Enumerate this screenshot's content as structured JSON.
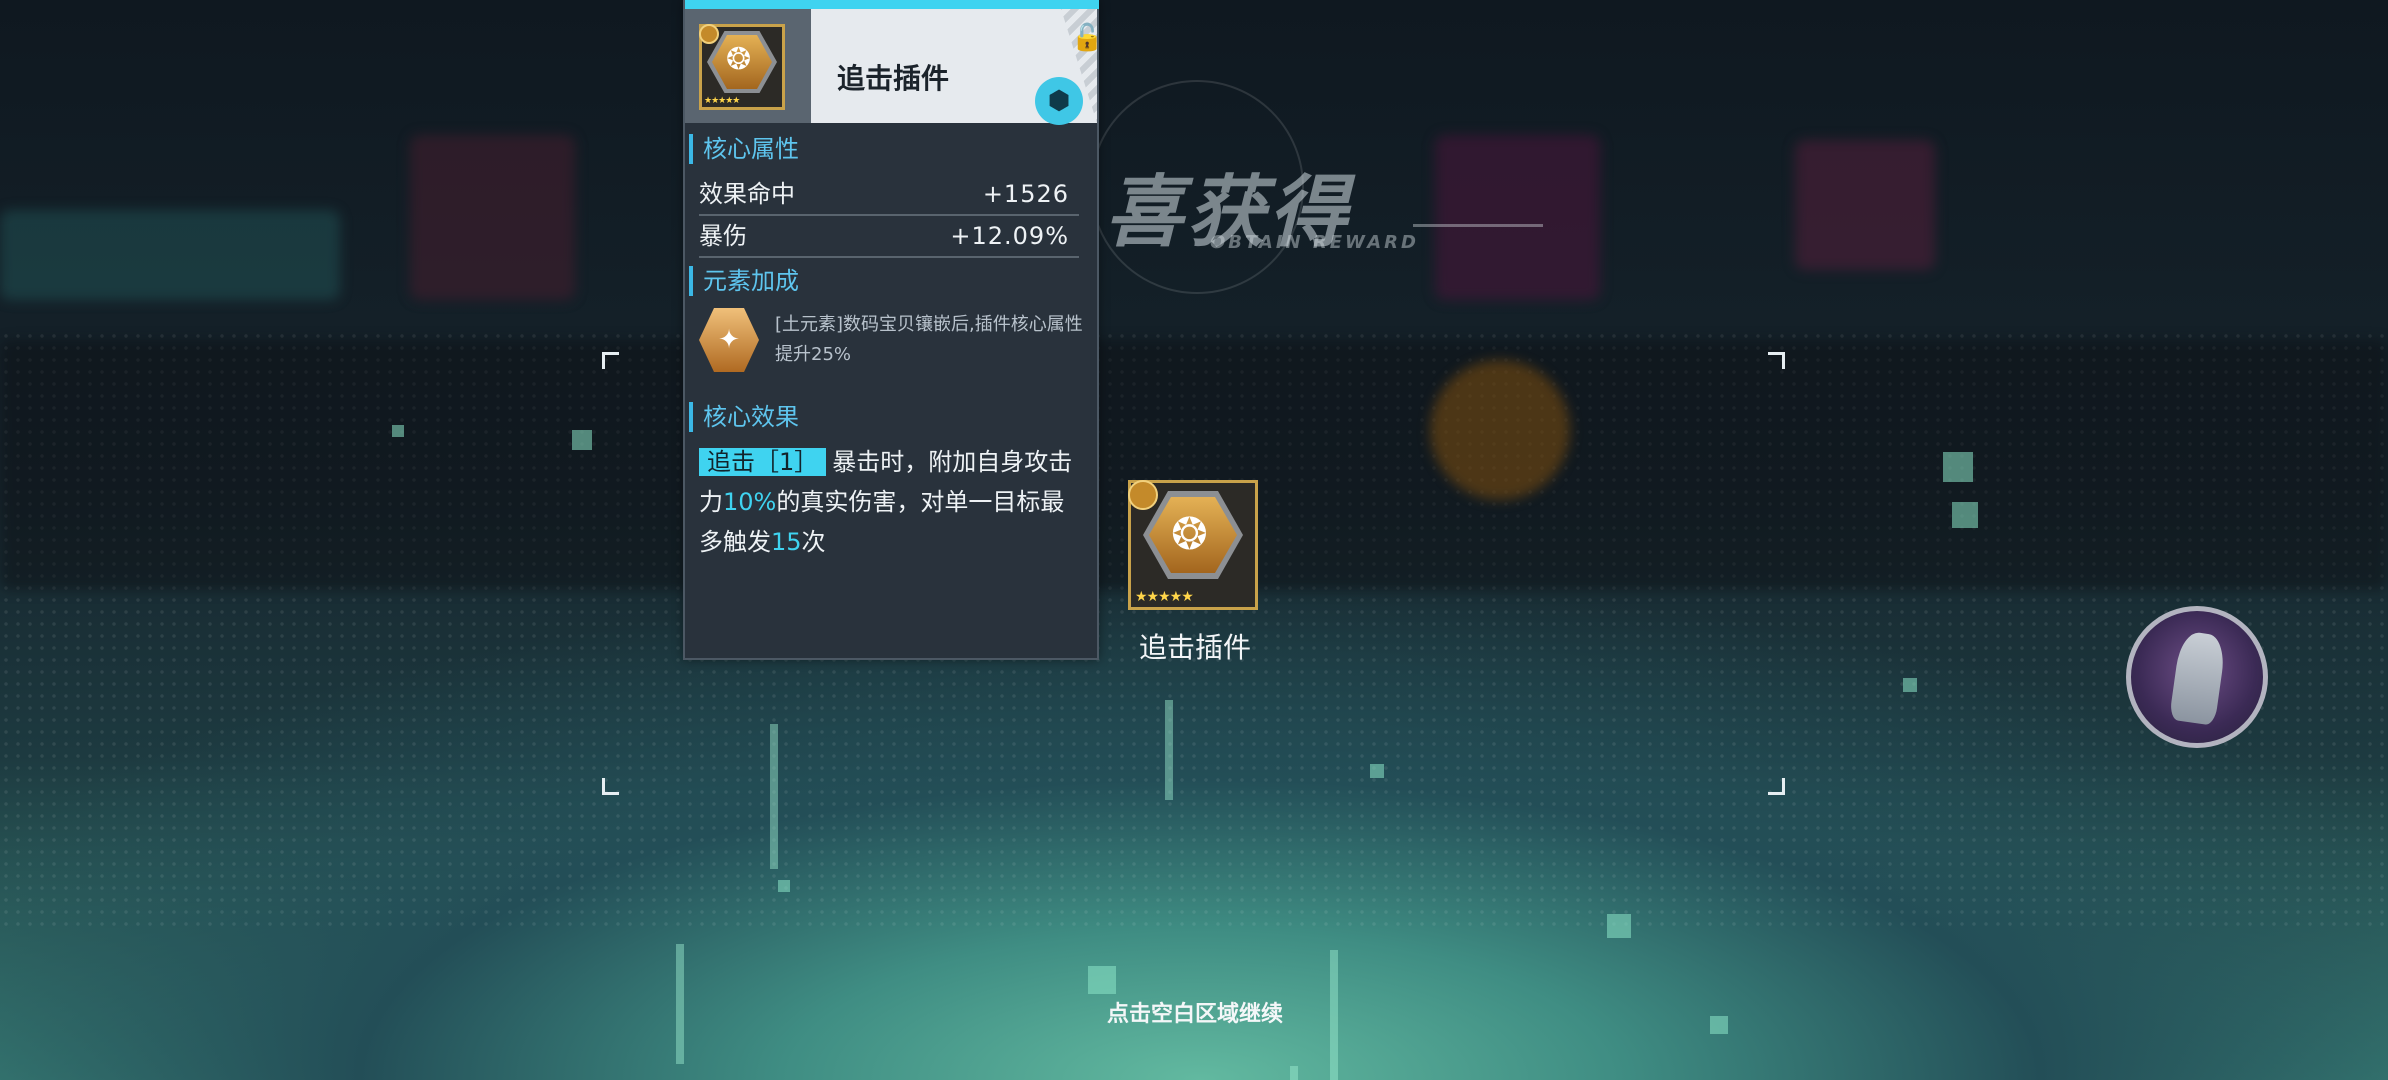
{
  "card": {
    "item_name": "追击插件",
    "item_stars": "★★★★★",
    "core_attributes": {
      "heading": "核心属性",
      "stats": [
        {
          "label": "效果命中",
          "value": "+1526"
        },
        {
          "label": "暴伤",
          "value": "+12.09%"
        }
      ]
    },
    "element_bonus": {
      "heading": "元素加成",
      "description": "[土元素]数码宝贝镶嵌后,插件核心属性提升25%"
    },
    "core_effect": {
      "heading": "核心效果",
      "tag": "追击［1］",
      "text_1": "暴击时，附加自身攻击力",
      "value_1": "10%",
      "text_2": "的真实伤害，对单一目标最多触发",
      "value_2": "15",
      "text_3": "次"
    },
    "icons": {
      "lock": "lock-icon",
      "cube": "cube-icon",
      "element": "earth-element-icon"
    }
  },
  "banner": {
    "title": "喜获得",
    "subtitle": "OBTAIN REWARD"
  },
  "reward": {
    "name": "追击插件",
    "stars": "★★★★★"
  },
  "continue_hint": "点击空白区域继续",
  "colors": {
    "accent": "#3fd3f0",
    "card_bg": "#29323c",
    "frame_gold": "#c9a24a"
  }
}
